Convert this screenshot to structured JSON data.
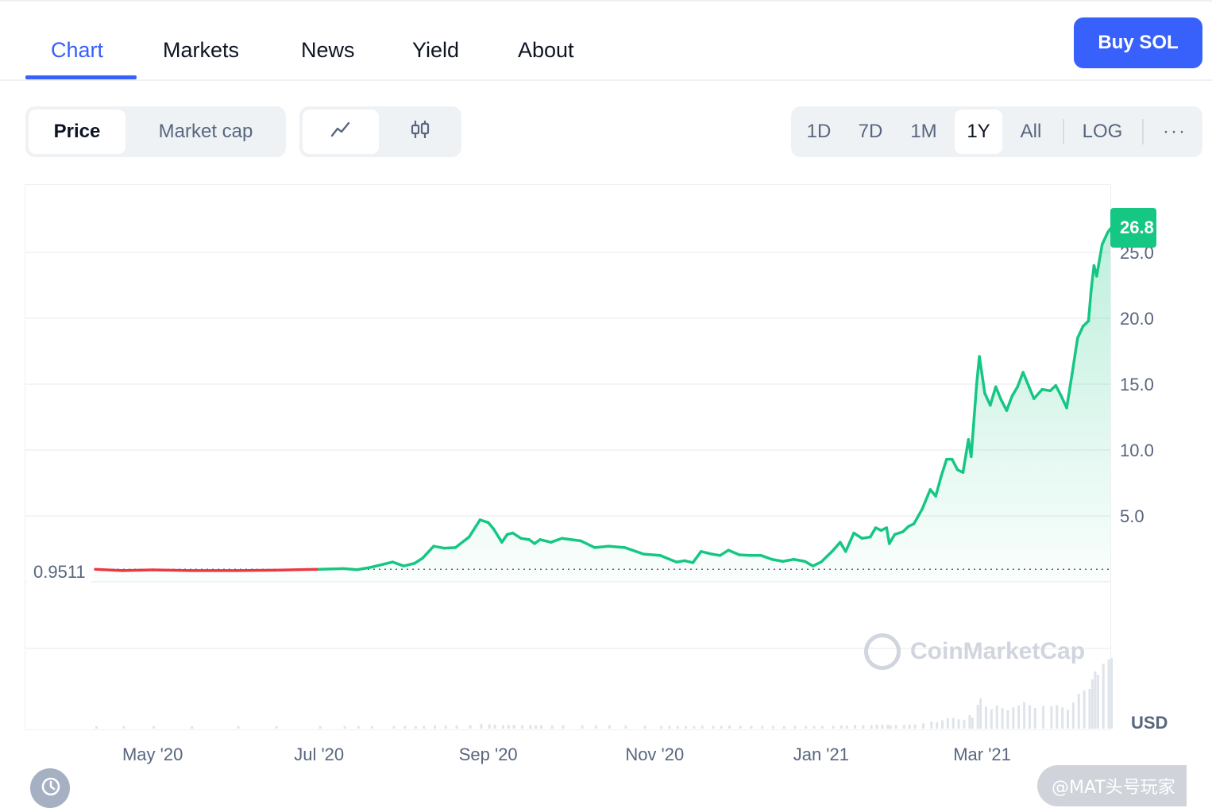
{
  "tabs": [
    {
      "label": "Chart",
      "active": true
    },
    {
      "label": "Markets",
      "active": false
    },
    {
      "label": "News",
      "active": false
    },
    {
      "label": "Yield",
      "active": false
    },
    {
      "label": "About",
      "active": false
    }
  ],
  "buy_button": "Buy SOL",
  "metric_toggle": {
    "options": [
      "Price",
      "Market cap"
    ],
    "selected": "Price"
  },
  "chart_style_toggle": {
    "options": [
      "line-chart-icon",
      "candlestick-icon"
    ],
    "selected": "line-chart-icon"
  },
  "ranges": {
    "options": [
      "1D",
      "7D",
      "1M",
      "1Y",
      "All"
    ],
    "selected": "1Y",
    "log_label": "LOG",
    "more_label": "···"
  },
  "currency_label": "USD",
  "watermark": "CoinMarketCap",
  "corner_badge": "@MAT头号玩家",
  "colors": {
    "accent": "#3861fb",
    "up": "#16c784",
    "down": "#ea3943",
    "grid": "#eef0f3",
    "muted": "#58667e"
  },
  "chart_data": {
    "type": "area",
    "title": "",
    "currency": "USD",
    "ylabel": "",
    "y_ticks": [
      5.0,
      10.0,
      15.0,
      20.0,
      25.0
    ],
    "y_tick_labels": [
      "5.0",
      "10.0",
      "15.0",
      "20.0",
      "25.0"
    ],
    "ylim": [
      0,
      27.0
    ],
    "x_tick_labels": [
      "May '20",
      "Jul '20",
      "Sep '20",
      "Nov '20",
      "Jan '21",
      "Mar '21"
    ],
    "x_ticks": [
      "2020-05-01",
      "2020-07-01",
      "2020-09-01",
      "2020-11-01",
      "2021-01-01",
      "2021-03-01"
    ],
    "open_price": 0.9511,
    "open_price_label": "0.9511",
    "last_price_label": "26.8",
    "series": [
      {
        "points": [
          [
            "2020-04-10",
            0.95
          ],
          [
            "2020-04-20",
            0.85
          ],
          [
            "2020-05-01",
            0.9
          ],
          [
            "2020-05-15",
            0.85
          ],
          [
            "2020-06-01",
            0.85
          ],
          [
            "2020-06-15",
            0.88
          ],
          [
            "2020-07-01",
            0.95
          ],
          [
            "2020-07-10",
            1.0
          ],
          [
            "2020-07-15",
            0.92
          ],
          [
            "2020-07-20",
            1.1
          ],
          [
            "2020-07-28",
            1.5
          ],
          [
            "2020-08-01",
            1.2
          ],
          [
            "2020-08-05",
            1.4
          ],
          [
            "2020-08-08",
            1.8
          ],
          [
            "2020-08-12",
            2.7
          ],
          [
            "2020-08-16",
            2.55
          ],
          [
            "2020-08-20",
            2.6
          ],
          [
            "2020-08-25",
            3.4
          ],
          [
            "2020-08-29",
            4.7
          ],
          [
            "2020-09-01",
            4.5
          ],
          [
            "2020-09-03",
            4.0
          ],
          [
            "2020-09-06",
            3.0
          ],
          [
            "2020-09-08",
            3.6
          ],
          [
            "2020-09-10",
            3.7
          ],
          [
            "2020-09-13",
            3.3
          ],
          [
            "2020-09-16",
            3.2
          ],
          [
            "2020-09-18",
            2.9
          ],
          [
            "2020-09-20",
            3.2
          ],
          [
            "2020-09-24",
            3.0
          ],
          [
            "2020-09-28",
            3.3
          ],
          [
            "2020-10-05",
            3.1
          ],
          [
            "2020-10-10",
            2.6
          ],
          [
            "2020-10-15",
            2.7
          ],
          [
            "2020-10-21",
            2.6
          ],
          [
            "2020-10-28",
            2.1
          ],
          [
            "2020-11-03",
            2.0
          ],
          [
            "2020-11-06",
            1.75
          ],
          [
            "2020-11-09",
            1.5
          ],
          [
            "2020-11-12",
            1.6
          ],
          [
            "2020-11-15",
            1.45
          ],
          [
            "2020-11-18",
            2.3
          ],
          [
            "2020-11-22",
            2.1
          ],
          [
            "2020-11-25",
            2.0
          ],
          [
            "2020-11-28",
            2.4
          ],
          [
            "2020-12-02",
            2.05
          ],
          [
            "2020-12-06",
            2.0
          ],
          [
            "2020-12-10",
            2.0
          ],
          [
            "2020-12-14",
            1.7
          ],
          [
            "2020-12-18",
            1.55
          ],
          [
            "2020-12-22",
            1.7
          ],
          [
            "2020-12-26",
            1.55
          ],
          [
            "2020-12-29",
            1.2
          ],
          [
            "2021-01-01",
            1.5
          ],
          [
            "2021-01-05",
            2.3
          ],
          [
            "2021-01-08",
            3.0
          ],
          [
            "2021-01-10",
            2.3
          ],
          [
            "2021-01-13",
            3.7
          ],
          [
            "2021-01-16",
            3.3
          ],
          [
            "2021-01-19",
            3.4
          ],
          [
            "2021-01-21",
            4.1
          ],
          [
            "2021-01-23",
            3.9
          ],
          [
            "2021-01-25",
            4.1
          ],
          [
            "2021-01-26",
            2.9
          ],
          [
            "2021-01-28",
            3.6
          ],
          [
            "2021-01-31",
            3.8
          ],
          [
            "2021-02-02",
            4.2
          ],
          [
            "2021-02-04",
            4.4
          ],
          [
            "2021-02-07",
            5.5
          ],
          [
            "2021-02-10",
            7.0
          ],
          [
            "2021-02-12",
            6.5
          ],
          [
            "2021-02-14",
            8.0
          ],
          [
            "2021-02-16",
            9.3
          ],
          [
            "2021-02-18",
            9.3
          ],
          [
            "2021-02-20",
            8.5
          ],
          [
            "2021-02-22",
            8.3
          ],
          [
            "2021-02-24",
            10.8
          ],
          [
            "2021-02-25",
            9.5
          ],
          [
            "2021-02-27",
            15.0
          ],
          [
            "2021-02-28",
            17.1
          ],
          [
            "2021-03-02",
            14.3
          ],
          [
            "2021-03-04",
            13.4
          ],
          [
            "2021-03-06",
            14.8
          ],
          [
            "2021-03-08",
            13.8
          ],
          [
            "2021-03-10",
            13.0
          ],
          [
            "2021-03-12",
            14.1
          ],
          [
            "2021-03-14",
            14.8
          ],
          [
            "2021-03-16",
            15.9
          ],
          [
            "2021-03-18",
            14.9
          ],
          [
            "2021-03-20",
            13.9
          ],
          [
            "2021-03-23",
            14.6
          ],
          [
            "2021-03-26",
            14.5
          ],
          [
            "2021-03-28",
            14.9
          ],
          [
            "2021-03-30",
            14.1
          ],
          [
            "2021-04-01",
            13.2
          ],
          [
            "2021-04-03",
            15.8
          ],
          [
            "2021-04-05",
            18.5
          ],
          [
            "2021-04-07",
            19.4
          ],
          [
            "2021-04-09",
            19.8
          ],
          [
            "2021-04-10",
            22.2
          ],
          [
            "2021-04-11",
            24.0
          ],
          [
            "2021-04-12",
            23.2
          ],
          [
            "2021-04-14",
            25.6
          ],
          [
            "2021-04-16",
            26.5
          ],
          [
            "2021-04-17",
            26.8
          ]
        ]
      }
    ]
  }
}
